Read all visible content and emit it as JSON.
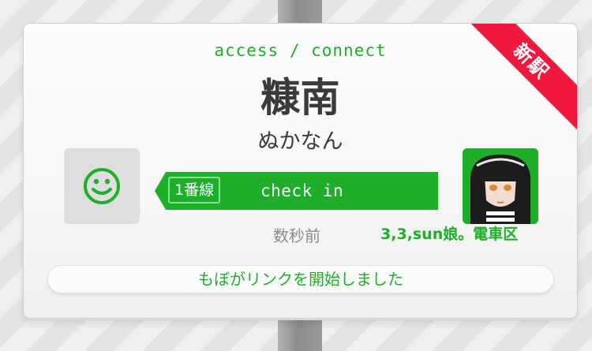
{
  "badge": {
    "new_station": "新駅"
  },
  "header": {
    "subtitle": "access / connect"
  },
  "station": {
    "name": "糠南",
    "reading": "ぬかなん"
  },
  "checkin": {
    "line_label": "1番線",
    "action_label": "check in"
  },
  "user": {
    "time_ago": "数秒前",
    "name": "3,3,sun娘。電車区"
  },
  "status": {
    "message": "もぼがリンクを開始しました"
  },
  "icons": {
    "left_avatar": "smiley-face-icon",
    "right_avatar": "character-portrait-icon"
  },
  "colors": {
    "accent": "#1fae2a",
    "ribbon": "#f0193d",
    "text_dark": "#3a3a3a",
    "text_muted": "#8a8a8a"
  }
}
